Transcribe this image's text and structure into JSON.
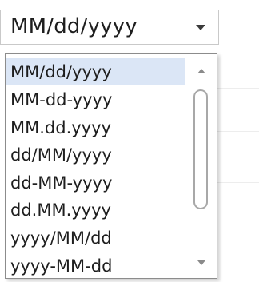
{
  "combo": {
    "value": "MM/dd/yyyy",
    "arrow_icon": "chevron-down-icon"
  },
  "dropdown": {
    "options": [
      "MM/dd/yyyy",
      "MM-dd-yyyy",
      "MM.dd.yyyy",
      "dd/MM/yyyy",
      "dd-MM-yyyy",
      "dd.MM.yyyy",
      "yyyy/MM/dd",
      "yyyy-MM-dd"
    ],
    "selected_index": 0
  },
  "scrollbar": {
    "up_icon": "scroll-up-arrow-icon",
    "down_icon": "scroll-down-arrow-icon"
  },
  "colors": {
    "selected_background": "#dbe6f6",
    "text": "#1e1e1e",
    "border": "#8c8c8c"
  }
}
